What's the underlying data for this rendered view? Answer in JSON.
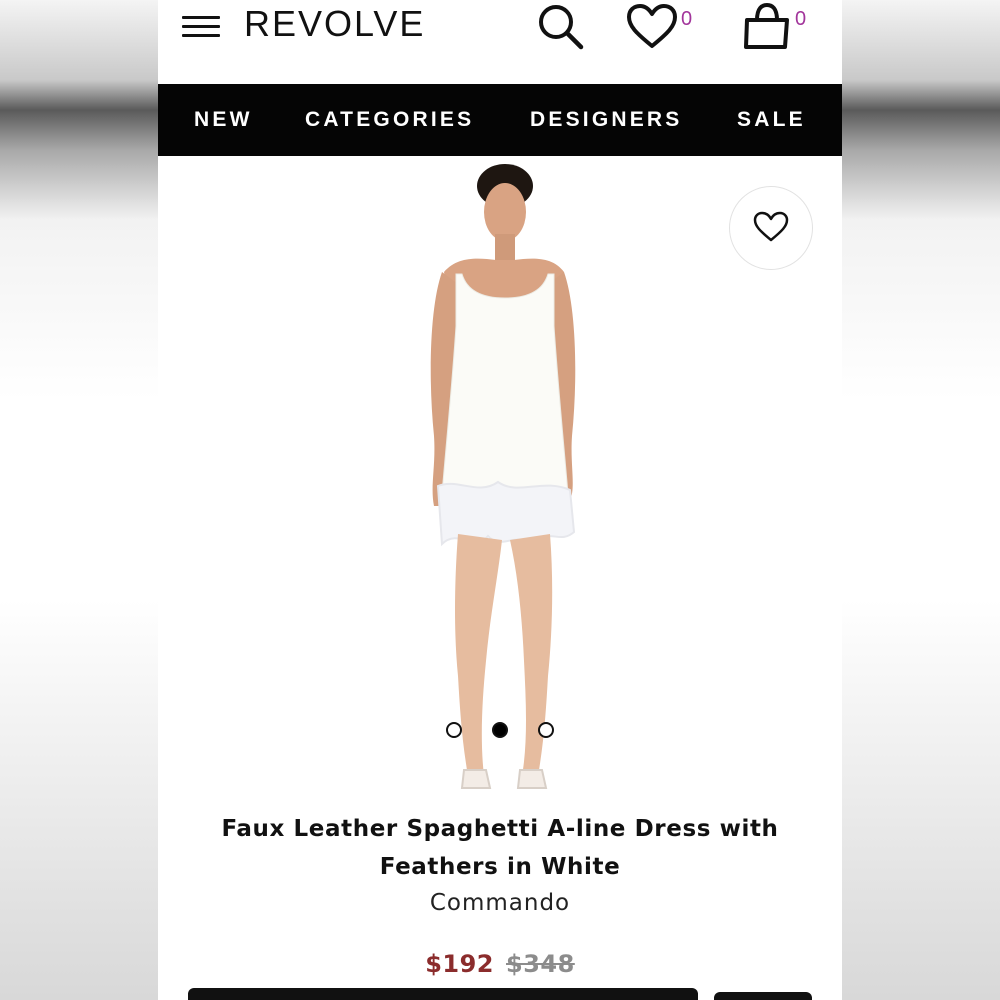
{
  "header": {
    "logo": "REVOLVE",
    "wishlist_count": "0",
    "bag_count": "0"
  },
  "nav": {
    "items": [
      {
        "label": "NEW"
      },
      {
        "label": "CATEGORIES"
      },
      {
        "label": "DESIGNERS"
      },
      {
        "label": "SALE"
      }
    ]
  },
  "carousel": {
    "image_count": 3,
    "active_index": 1
  },
  "product": {
    "title_line1": "Faux Leather Spaghetti A-line Dress with",
    "title_line2": "Feathers in White",
    "brand": "Commando",
    "sale_price": "$192",
    "original_price": "$348"
  },
  "colors": {
    "accent_count": "#a2359b",
    "sale_price": "#8b2c2c",
    "nav_bg": "#050505"
  },
  "icons": [
    "menu-icon",
    "search-icon",
    "heart-icon",
    "bag-icon",
    "heart-outline-icon"
  ]
}
